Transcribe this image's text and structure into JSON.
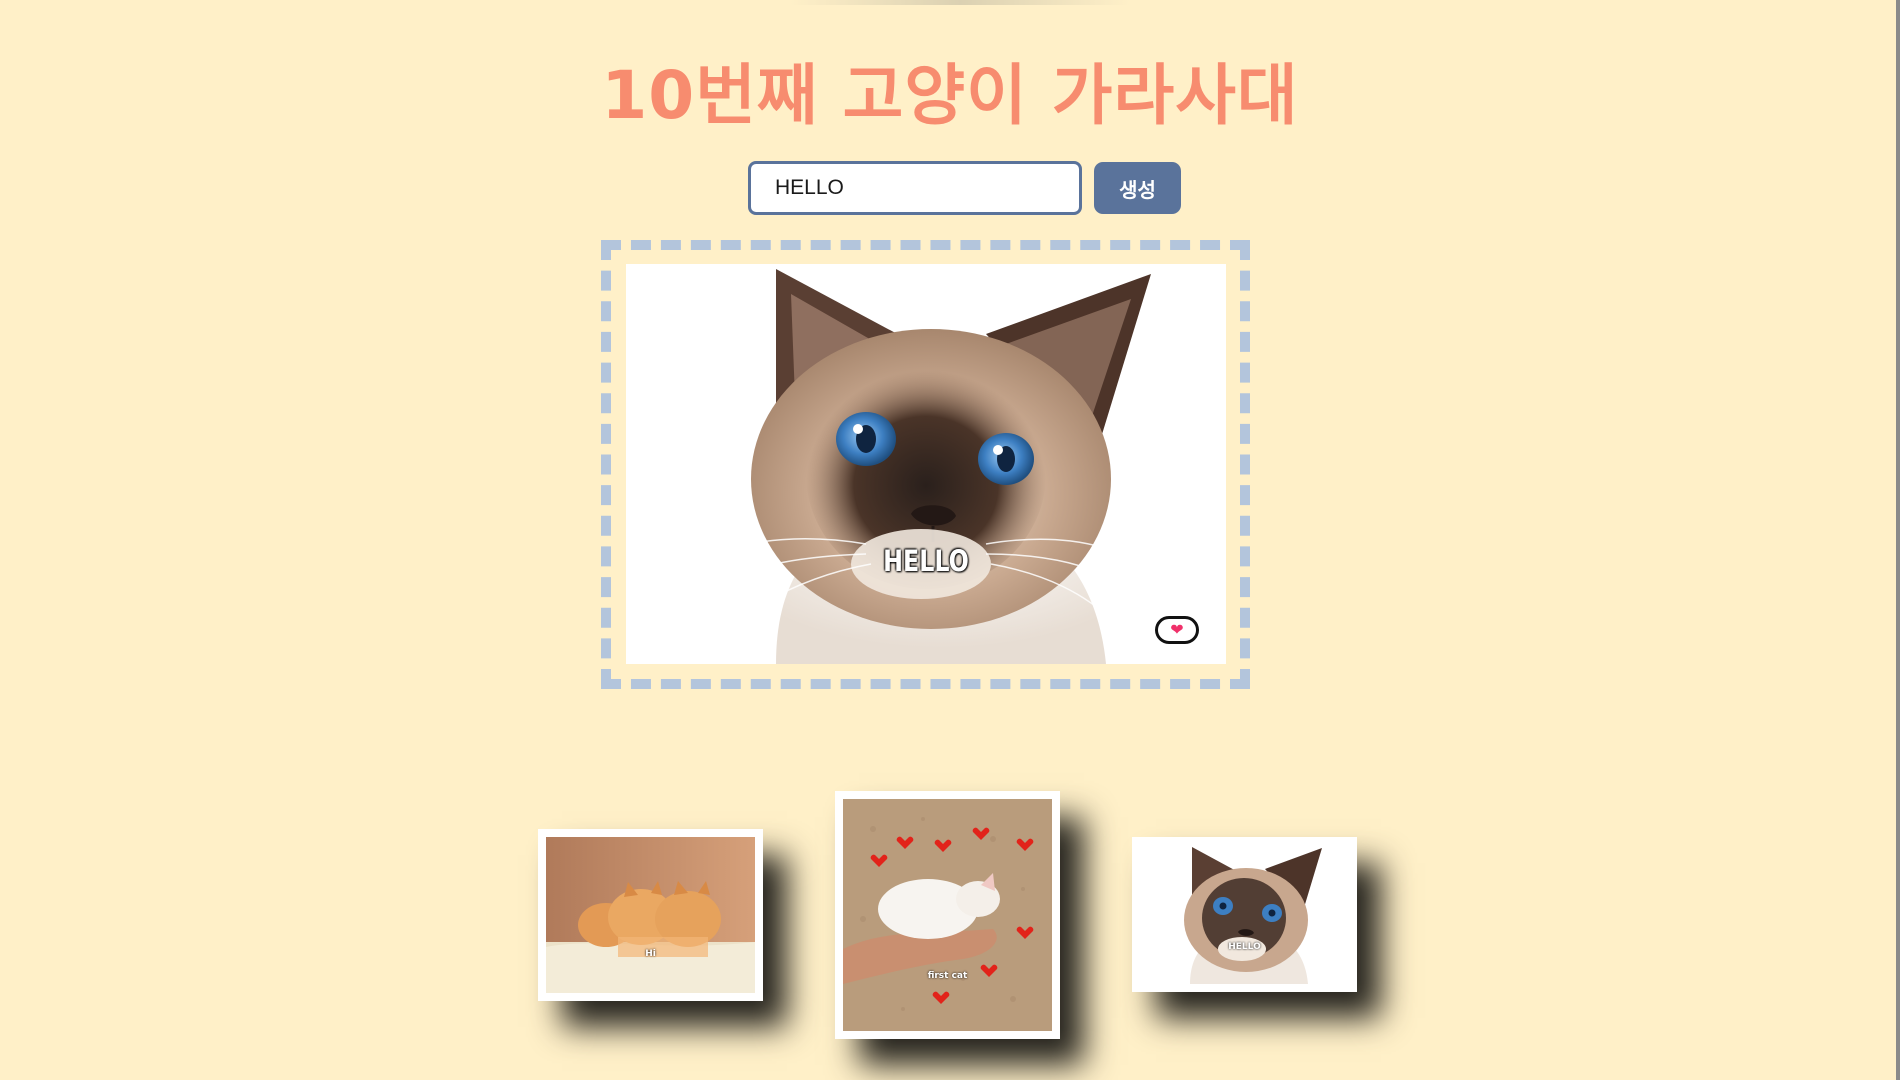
{
  "title": "10번째 고양이 가라사대",
  "form": {
    "input_value": "HELLO",
    "button_label": "생성"
  },
  "main_card": {
    "caption": "HELLO",
    "like_icon": "heart-icon"
  },
  "gallery": {
    "items": [
      {
        "caption": "Hi",
        "subject": "two orange kittens"
      },
      {
        "caption": "first cat",
        "subject": "white kitten in hand with hearts"
      },
      {
        "caption": "HELLO",
        "subject": "siamese cat"
      }
    ]
  },
  "colors": {
    "background": "#fff0c8",
    "title": "#f78c6f",
    "accent": "#5a739b",
    "frame_dash": "#b3c5dc",
    "heart": "#f0306a"
  }
}
